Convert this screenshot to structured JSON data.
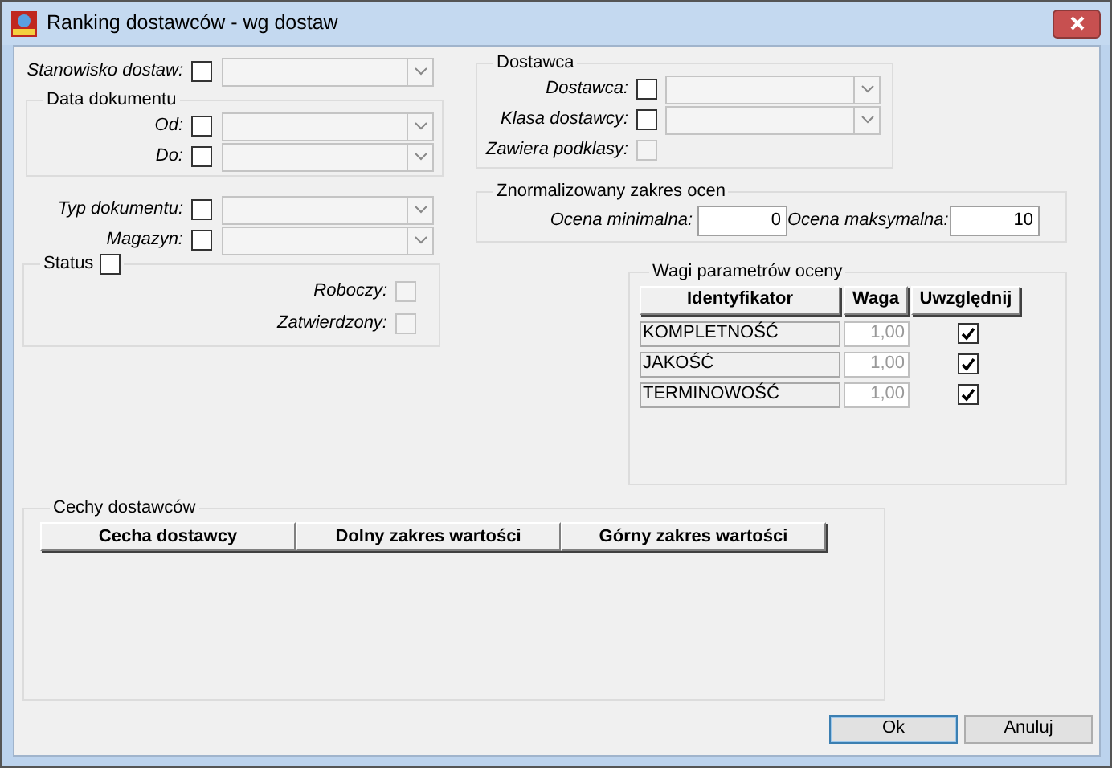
{
  "window": {
    "title": "Ranking dostawców - wg dostaw"
  },
  "stanowisko": {
    "label": "Stanowisko dostaw:",
    "checked": false
  },
  "data_dokumentu": {
    "title": "Data dokumentu",
    "fields": [
      {
        "label": "Od:",
        "checked": false
      },
      {
        "label": "Do:",
        "checked": false
      }
    ]
  },
  "document_fields": [
    {
      "label": "Typ dokumentu:",
      "checked": false
    },
    {
      "label": "Magazyn:",
      "checked": false
    }
  ],
  "status": {
    "title": "Status",
    "checked": false,
    "options": [
      {
        "label": "Roboczy:",
        "checked": false,
        "disabled": true
      },
      {
        "label": "Zatwierdzony:",
        "checked": false,
        "disabled": true
      }
    ]
  },
  "dostawca": {
    "title": "Dostawca",
    "fields": [
      {
        "label": "Dostawca:",
        "checked": false
      },
      {
        "label": "Klasa dostawcy:",
        "checked": false
      }
    ],
    "subclasses": {
      "label": "Zawiera podklasy:",
      "checked": false,
      "disabled": true
    }
  },
  "zakres": {
    "title": "Znormalizowany zakres ocen",
    "fields": [
      {
        "label": "Ocena minimalna:",
        "value": "0"
      },
      {
        "label": "Ocena maksymalna:",
        "value": "10"
      }
    ]
  },
  "wagi": {
    "title": "Wagi parametrów oceny",
    "columns": [
      "Identyfikator",
      "Waga",
      "Uwzględnij"
    ],
    "rows": [
      {
        "identyfikator": "KOMPLETNOŚĆ",
        "waga": "1,00",
        "uwzglednij": true
      },
      {
        "identyfikator": "JAKOŚĆ",
        "waga": "1,00",
        "uwzglednij": true
      },
      {
        "identyfikator": "TERMINOWOŚĆ",
        "waga": "1,00",
        "uwzglednij": true
      }
    ]
  },
  "cechy": {
    "title": "Cechy dostawców",
    "columns": [
      "Cecha dostawcy",
      "Dolny zakres wartości",
      "Górny zakres wartości"
    ]
  },
  "buttons": [
    {
      "label": "Ok",
      "default": true
    },
    {
      "label": "Anuluj",
      "default": false
    }
  ]
}
